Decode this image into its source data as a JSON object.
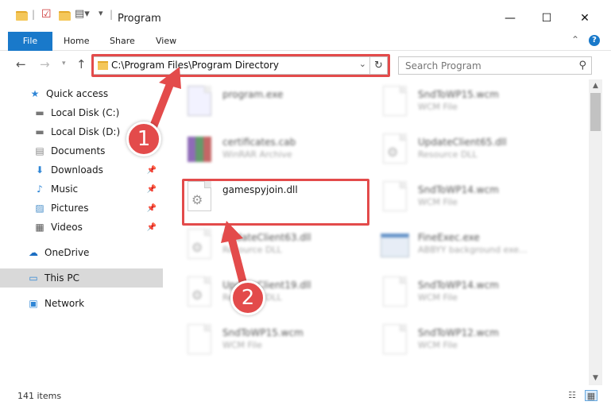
{
  "window": {
    "title": "Program",
    "minimize": "—",
    "maximize": "☐",
    "close": "✕"
  },
  "ribbon": {
    "tabs": [
      "File",
      "Home",
      "Share",
      "View"
    ],
    "help": "?"
  },
  "nav": {
    "address": "C:\\Program Files\\Program Directory",
    "search_placeholder": "Search Program"
  },
  "sidebar": {
    "items": [
      {
        "label": "Quick access",
        "icon": "star-icon"
      },
      {
        "label": "Local Disk (C:)",
        "icon": "drive-icon"
      },
      {
        "label": "Local Disk (D:)",
        "icon": "drive-icon"
      },
      {
        "label": "Documents",
        "icon": "documents-icon"
      },
      {
        "label": "Downloads",
        "icon": "download-icon"
      },
      {
        "label": "Music",
        "icon": "music-icon"
      },
      {
        "label": "Pictures",
        "icon": "pictures-icon"
      },
      {
        "label": "Videos",
        "icon": "videos-icon"
      },
      {
        "label": "OneDrive",
        "icon": "cloud-icon"
      },
      {
        "label": "This PC",
        "icon": "computer-icon"
      },
      {
        "label": "Network",
        "icon": "network-icon"
      }
    ]
  },
  "files": {
    "left": [
      {
        "name": "program.exe",
        "type": ""
      },
      {
        "name": "certificates.cab",
        "type": "WinRAR Archive"
      },
      {
        "name": "gamespyjoin.dll",
        "type": ""
      },
      {
        "name": "UpdateClient63.dll",
        "type": "Resource DLL"
      },
      {
        "name": "UpdateClient19.dll",
        "type": "Resource DLL"
      },
      {
        "name": "SndToWP15.wcm",
        "type": "WCM File"
      }
    ],
    "right": [
      {
        "name": "SndToWP15.wcm",
        "type": "WCM File"
      },
      {
        "name": "UpdateClient65.dll",
        "type": "Resource DLL"
      },
      {
        "name": "SndToWP14.wcm",
        "type": "WCM File"
      },
      {
        "name": "FineExec.exe",
        "type": "ABBYY background exe..."
      },
      {
        "name": "SndToWP14.wcm",
        "type": "WCM File"
      },
      {
        "name": "SndToWP12.wcm",
        "type": "WCM File"
      }
    ]
  },
  "status": {
    "count": "141 items"
  },
  "annotations": {
    "step1": "1",
    "step2": "2",
    "color": "#e34b4b"
  }
}
